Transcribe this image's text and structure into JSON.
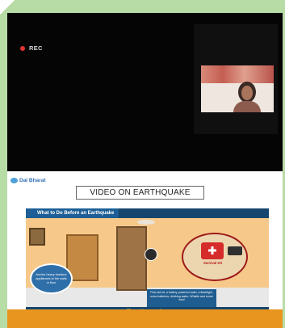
{
  "recording": {
    "label": "REC"
  },
  "participant": {
    "name": ""
  },
  "slide": {
    "logo": {
      "name": "Dal Bharat",
      "subline": ""
    },
    "title": "VIDEO ON EARTHQUAKE",
    "illustration": {
      "heading": "What to Do Before an Earthquake",
      "left_note": "Anchor heavy furniture appliances to the walls or floor",
      "kit_label": "Survival Kit",
      "caption": "First aid kit, a battery powered radio, a flashlight, extra batteries, drinking water, Whistle and some food",
      "footer": "Earthquake"
    }
  },
  "colors": {
    "rec": "#e0332f",
    "footer_band": "#e8951f",
    "slide_bar": "#16466e"
  }
}
